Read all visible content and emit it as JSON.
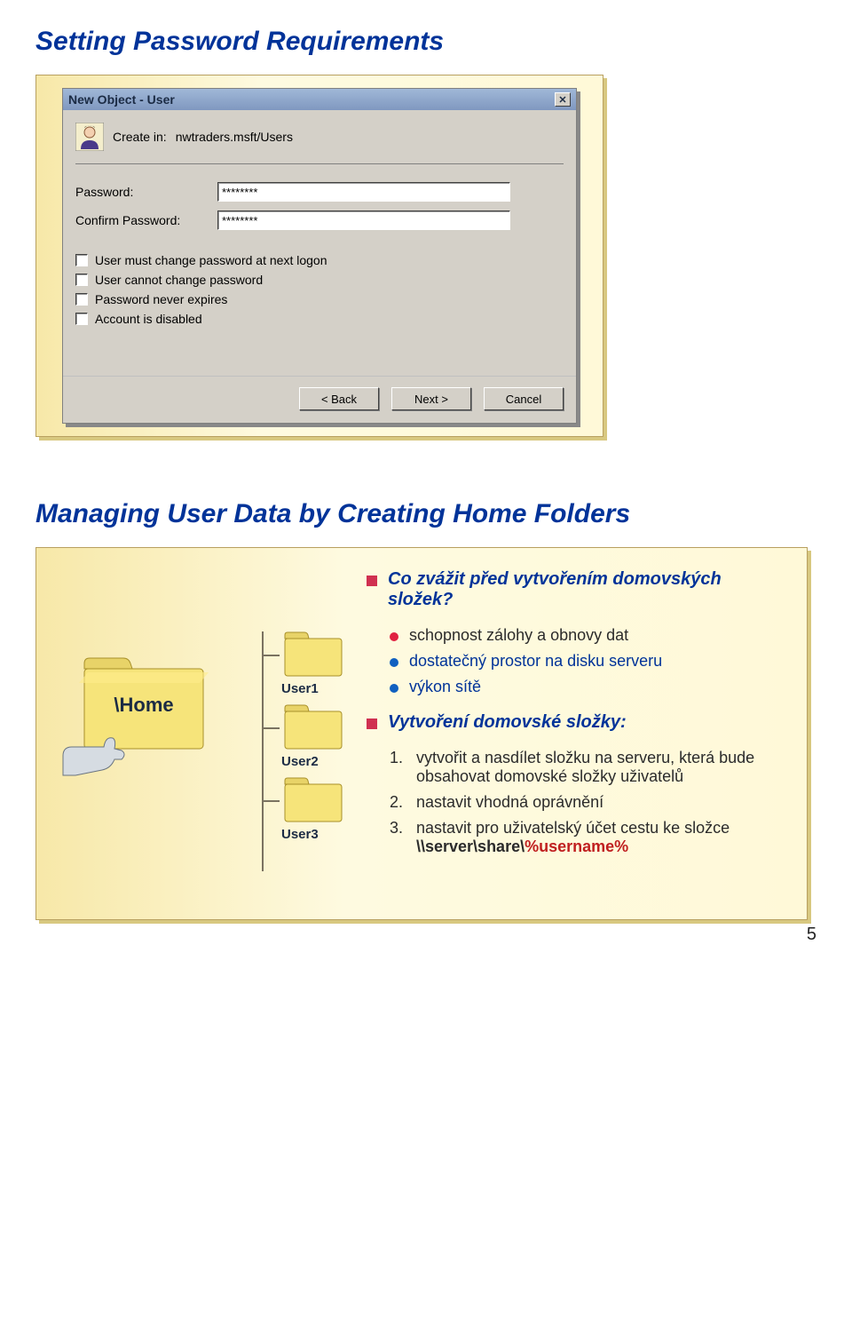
{
  "slide1": {
    "title": "Setting Password Requirements",
    "dialog": {
      "window_title": "New Object - User",
      "createin_label": "Create in:",
      "createin_path": "nwtraders.msft/Users",
      "password_label": "Password:",
      "password_value": "********",
      "confirm_label": "Confirm Password:",
      "confirm_value": "********",
      "chk1": "User must change password at next logon",
      "chk2": "User cannot change password",
      "chk3": "Password never expires",
      "chk4": "Account is disabled",
      "btn_back": "< Back",
      "btn_next": "Next >",
      "btn_cancel": "Cancel"
    }
  },
  "slide2": {
    "title": "Managing User Data by Creating Home Folders",
    "home_label": "\\Home",
    "folders": [
      "User1",
      "User2",
      "User3"
    ],
    "q1": "Co zvážit před vytvořením domovských složek?",
    "q1_items": [
      "schopnost zálohy a obnovy dat",
      "dostatečný prostor na disku serveru",
      "výkon sítě"
    ],
    "q2": "Vytvoření domovské složky:",
    "q2_items": [
      "vytvořit a nasdílet složku na serveru, která bude obsahovat domovské složky uživatelů",
      "nastavit vhodná oprávnění",
      "nastavit pro uživatelský účet cestu ke složce"
    ],
    "path_prefix": "\\\\server\\share\\",
    "path_var": "%username%"
  },
  "page_number": "5"
}
